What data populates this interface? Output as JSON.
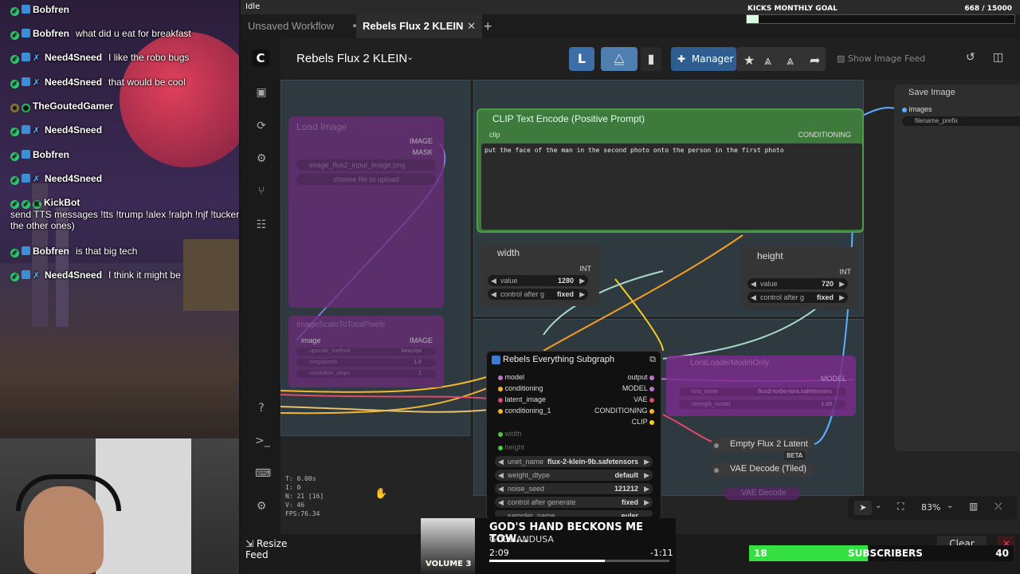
{
  "chat": {
    "messages": [
      {
        "user": "Bobfren",
        "text": ""
      },
      {
        "user": "Bobfren",
        "text": "what did u eat for breakfast"
      },
      {
        "user": "Need4Sneed",
        "text": "I like the robo bugs"
      },
      {
        "user": "Need4Sneed",
        "text": "that would be cool"
      },
      {
        "user": "TheGoutedGamer",
        "text": ""
      },
      {
        "user": "Need4Sneed",
        "text": ""
      },
      {
        "user": "Bobfren",
        "text": ""
      },
      {
        "user": "Need4Sneed",
        "text": ""
      },
      {
        "user": "KickBot",
        "text": "send TTS messages !tts !trump !alex !ralph !njf !tucker !teddy !bean !dambit (and all the other ones)"
      },
      {
        "user": "Bobfren",
        "text": "is that big tech"
      },
      {
        "user": "Need4Sneed",
        "text": "I think it might be"
      }
    ]
  },
  "status": {
    "idle": "Idle"
  },
  "kicks": {
    "label": "KICKS MONTHLY GOAL",
    "count": "668 / 15000",
    "progress": 0.045
  },
  "tabs": {
    "items": [
      {
        "label": "Unsaved Workflow"
      },
      {
        "label": "Rebels Flux 2 KLEIN"
      }
    ]
  },
  "topbar": {
    "workflow_title": "Rebels Flux 2 KLEIN",
    "manager_label": "Manager",
    "show_feed_label": "Show Image Feed"
  },
  "nodes": {
    "load_image": {
      "title": "Load Image",
      "out_image": "IMAGE",
      "out_mask": "MASK",
      "file": "image_flux2_input_image.png",
      "upload": "choose file to upload"
    },
    "image_scale": {
      "title": "ImageScaleToTotalPixels",
      "in_image": "image",
      "out_image": "IMAGE",
      "w1_label": "upscale_method",
      "w1_value": "lanczos",
      "w2_label": "megapixels",
      "w2_value": "1.0",
      "w3_label": "resolution_steps",
      "w3_value": "1"
    },
    "clip": {
      "title": "CLIP Text Encode (Positive Prompt)",
      "in_clip": "clip",
      "out_cond": "CONDITIONING",
      "prompt": "put the face of the man in the second photo onto the person in the first photo"
    },
    "width": {
      "title": "width",
      "out": "INT",
      "value_label": "value",
      "value": "1280",
      "control_label": "control after g",
      "control_value": "fixed"
    },
    "height": {
      "title": "height",
      "out": "INT",
      "value_label": "value",
      "value": "720",
      "control_label": "control after g",
      "control_value": "fixed"
    },
    "subgraph": {
      "title": "Rebels Everything Subgraph",
      "inputs": [
        "model",
        "conditioning",
        "latent_image",
        "conditioning_1"
      ],
      "outputs": [
        "output",
        "MODEL",
        "VAE",
        "CONDITIONING",
        "CLIP"
      ],
      "extra_inputs": [
        "width",
        "height"
      ],
      "widgets": [
        {
          "label": "unet_name",
          "value": "flux-2-klein-9b.safetensors"
        },
        {
          "label": "weight_dtype",
          "value": "default"
        },
        {
          "label": "noise_seed",
          "value": "121212"
        },
        {
          "label": "control after generate",
          "value": "fixed"
        },
        {
          "label": "sampler_name",
          "value": "euler"
        }
      ]
    },
    "lora": {
      "title": "LoraLoaderModelOnly",
      "out": "MODEL",
      "w1_label": "lora_name",
      "w1_value": "flux2-turbo-lora.safetensors",
      "w2_label": "strength_model",
      "w2_value": "1.00"
    },
    "empty_latent": {
      "title": "Empty Flux 2 Latent",
      "badge": "BETA"
    },
    "vae_decode_tiled": {
      "title": "VAE Decode (Tiled)"
    },
    "vae_decode": {
      "title": "VAE Decode"
    },
    "save_image": {
      "title": "Save Image",
      "in_images": "images",
      "prefix": "filename_prefix"
    }
  },
  "stats": {
    "t": "T: 0.00s",
    "i": "I: 0",
    "n": "N: 21 [16]",
    "v": "V: 46",
    "fps": "FPS:76.34"
  },
  "bottom": {
    "resize_feed": "Resize Feed",
    "clear": "Clear",
    "zoom": "83%"
  },
  "music": {
    "title": "GOD'S HAND BECKONS ME TOW...",
    "artist": "GODHANDUSA",
    "elapsed": "2:09",
    "remaining": "-1:11",
    "progress": 0.64,
    "album_text": "VOLUME 3"
  },
  "subs": {
    "current": "18",
    "label": "SUBSCRIBERS",
    "goal": "40",
    "progress": 0.45
  }
}
